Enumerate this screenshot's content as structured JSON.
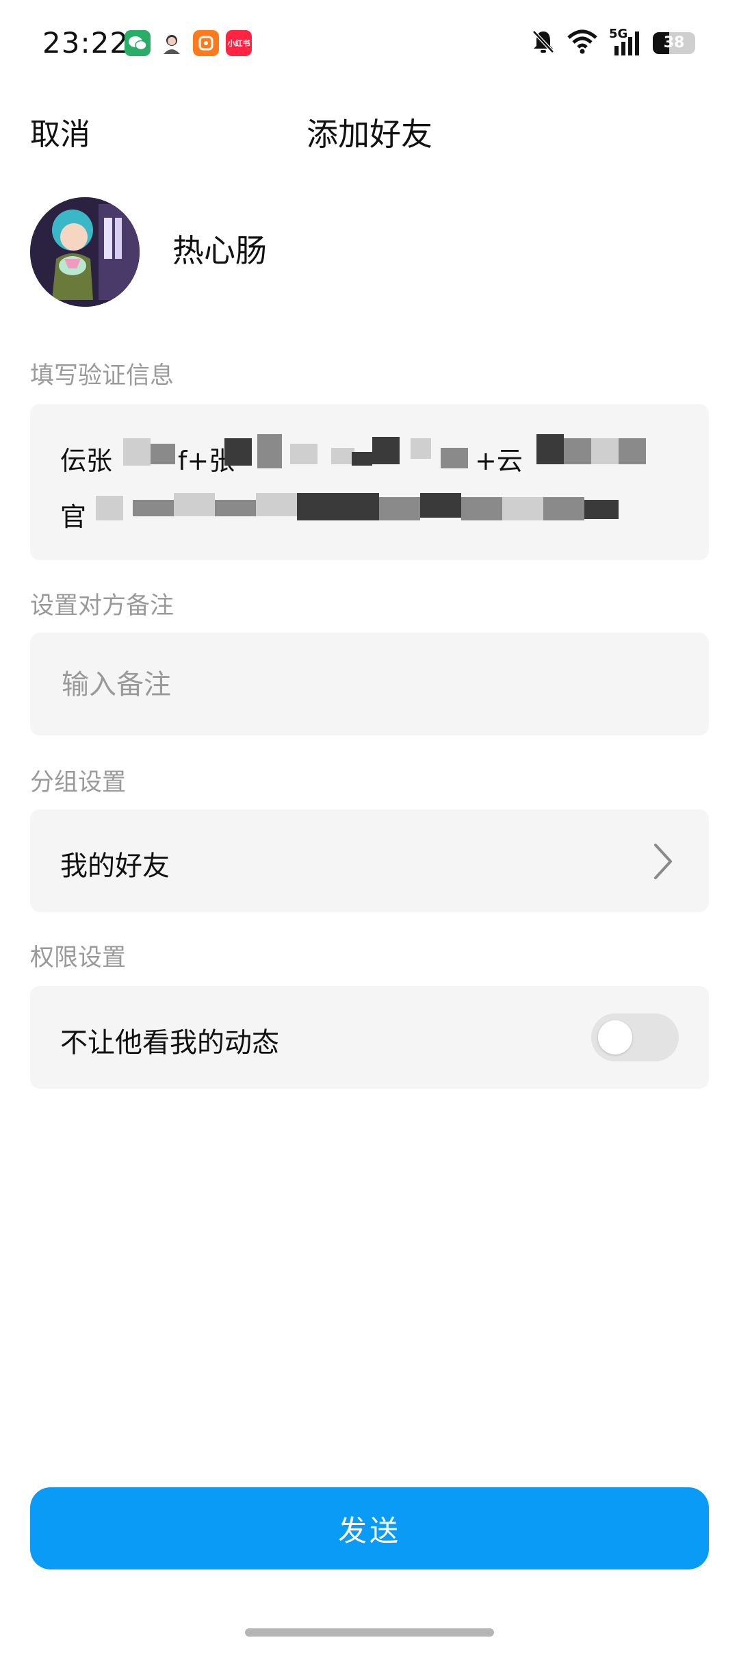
{
  "status_bar": {
    "time": "23:22",
    "apps": [
      {
        "icon": "wechat-icon",
        "color": "#2aae67",
        "label": ""
      },
      {
        "icon": "profile-app-icon",
        "color": "#ffffff",
        "label": ""
      },
      {
        "icon": "shopping-app-icon",
        "color": "#ff7a1a",
        "label": ""
      },
      {
        "icon": "xiaohongshu-icon",
        "color": "#ff2442",
        "label": "小红书"
      }
    ],
    "network": "5G",
    "battery_level": 38,
    "battery_text": "38"
  },
  "header": {
    "cancel_label": "取消",
    "title": "添加好友"
  },
  "profile": {
    "nickname": "热心肠"
  },
  "verify": {
    "label": "填写验证信息",
    "line1": "伝张",
    "line1b": "f+张",
    "line1c": "+云",
    "line2": "官"
  },
  "remark": {
    "label": "设置对方备注",
    "placeholder": "输入备注",
    "value": ""
  },
  "group": {
    "label": "分组设置",
    "value": "我的好友"
  },
  "permission": {
    "label": "权限设置",
    "option_label": "不让他看我的动态",
    "enabled": false
  },
  "send_label": "发送",
  "colors": {
    "accent": "#0a9bf6",
    "card_bg": "#f5f5f5",
    "muted_text": "#9a9a9a"
  }
}
